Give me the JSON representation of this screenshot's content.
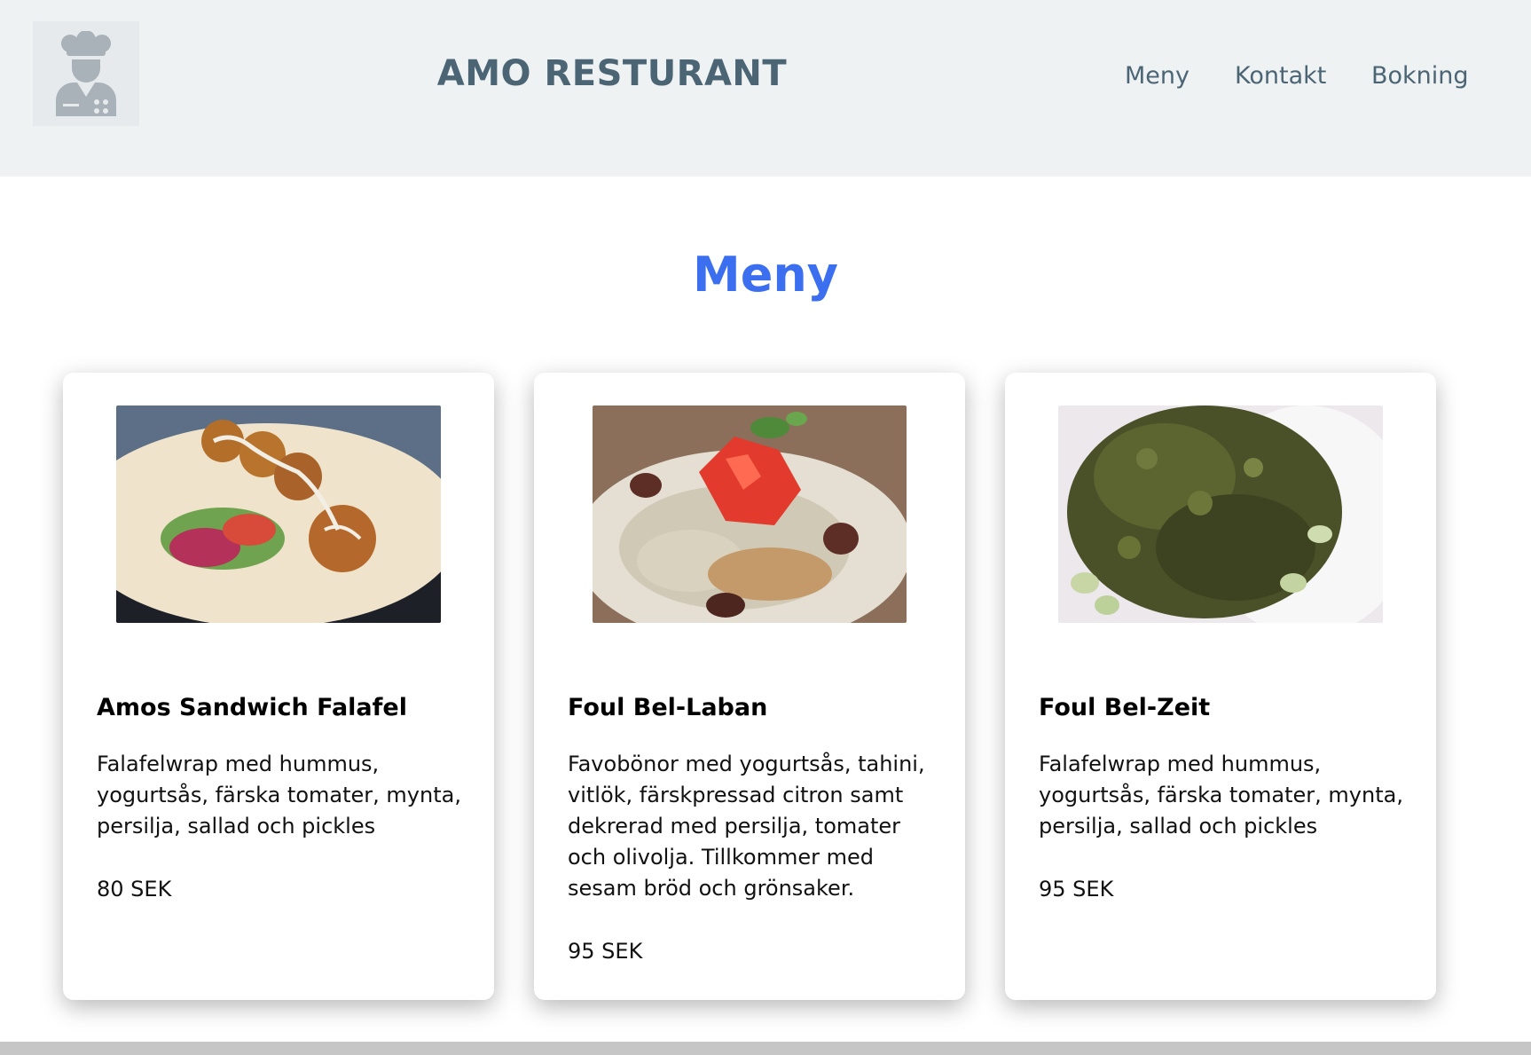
{
  "header": {
    "brand": "AMO RESTURANT",
    "logo_icon": "chef-icon",
    "nav": [
      {
        "label": "Meny"
      },
      {
        "label": "Kontakt"
      },
      {
        "label": "Bokning"
      }
    ]
  },
  "main": {
    "title": "Meny",
    "title_color": "#3b6ff0",
    "menu_items": [
      {
        "name": "Amos Sandwich Falafel",
        "description": "Falafelwrap med hummus, yogurtsås, färska tomater, mynta, persilja, sallad och pickles",
        "price": "80 SEK",
        "image_icon": "falafel-wrap-photo"
      },
      {
        "name": "Foul Bel-Laban",
        "description": "Favobönor med yogurtsås, tahini, vitlök, färskpressad citron samt dekrerad med persilja, tomater och olivolja. Tillkommer med sesam bröd och grönsaker.",
        "price": "95 SEK",
        "image_icon": "foul-bel-laban-photo"
      },
      {
        "name": "Foul Bel-Zeit",
        "description": "Falafelwrap med hummus, yogurtsås, färska tomater, mynta, persilja, sallad och pickles",
        "price": "95 SEK",
        "image_icon": "foul-bel-zeit-photo"
      }
    ]
  }
}
